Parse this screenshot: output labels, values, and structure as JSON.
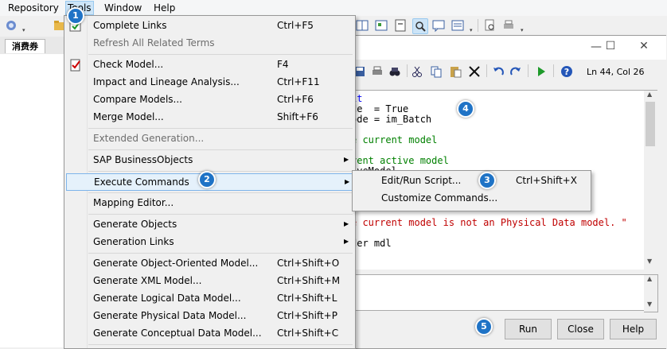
{
  "menubar": {
    "items": [
      "Repository",
      "Tools",
      "Window",
      "Help"
    ]
  },
  "tab": {
    "label": "消费券"
  },
  "tools_menu": {
    "items": [
      {
        "label": "Complete Links",
        "shortcut": "Ctrl+F5"
      },
      {
        "label": "Refresh All Related Terms",
        "shortcut": ""
      },
      {
        "label": "Check Model...",
        "shortcut": "F4"
      },
      {
        "label": "Impact and Lineage Analysis...",
        "shortcut": "Ctrl+F11"
      },
      {
        "label": "Compare Models...",
        "shortcut": "Ctrl+F6"
      },
      {
        "label": "Merge Model...",
        "shortcut": "Shift+F6"
      },
      {
        "label": "Extended Generation...",
        "shortcut": ""
      },
      {
        "label": "SAP BusinessObjects",
        "shortcut": ""
      },
      {
        "label": "Execute Commands",
        "shortcut": ""
      },
      {
        "label": "Mapping Editor...",
        "shortcut": ""
      },
      {
        "label": "Generate Objects",
        "shortcut": ""
      },
      {
        "label": "Generation Links",
        "shortcut": ""
      },
      {
        "label": "Generate Object-Oriented Model...",
        "shortcut": "Ctrl+Shift+O"
      },
      {
        "label": "Generate XML Model...",
        "shortcut": "Ctrl+Shift+M"
      },
      {
        "label": "Generate Logical Data Model...",
        "shortcut": "Ctrl+Shift+L"
      },
      {
        "label": "Generate Physical Data Model...",
        "shortcut": "Ctrl+Shift+P"
      },
      {
        "label": "Generate Conceptual Data Model...",
        "shortcut": "Ctrl+Shift+C"
      }
    ]
  },
  "submenu": {
    "items": [
      {
        "label": "Edit/Run Script...",
        "shortcut": "Ctrl+Shift+X"
      },
      {
        "label": "Customize Commands...",
        "shortcut": ""
      }
    ]
  },
  "dialog": {
    "status": "Ln 44, Col 26",
    "code_lines": [
      {
        "text": "it",
        "color": "#0000ff"
      },
      {
        "text": "de  = True",
        "color": "#000000"
      },
      {
        "text": "ode = im_Batch",
        "color": "#000000"
      },
      {
        "text": "",
        "color": "#000000"
      },
      {
        "text": "e current model",
        "color": "#008000"
      },
      {
        "text": "",
        "color": "#000000"
      },
      {
        "text": "rent active model",
        "color": "#008000"
      },
      {
        "text": "iveModel",
        "color": "#000000"
      },
      {
        "text": "",
        "color": "#000000"
      },
      {
        "text": "",
        "color": "#000000"
      },
      {
        "text": "",
        "color": "#000000"
      },
      {
        "text": "",
        "color": "#000000"
      },
      {
        "text": "e current model is not an Physical Data model. \"",
        "color": "#c00000"
      },
      {
        "text": "",
        "color": "#000000"
      },
      {
        "text": "der mdl",
        "color": "#000000"
      }
    ],
    "buttons": {
      "run": "Run",
      "close": "Close",
      "help": "Help"
    }
  },
  "badges": [
    "1",
    "2",
    "3",
    "4",
    "5"
  ],
  "colors": {
    "badge": "#1f73c6",
    "menu_highlight": "#e5f1fb"
  }
}
